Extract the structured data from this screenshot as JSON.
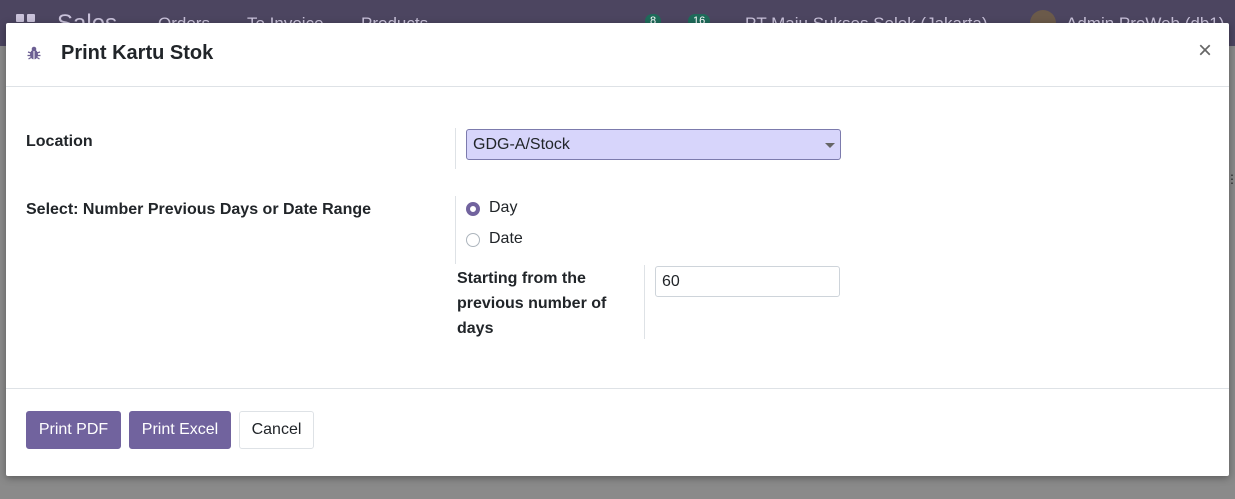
{
  "background": {
    "app_name": "Sales",
    "menu": [
      "Orders",
      "To Invoice",
      "Products"
    ],
    "messages_count": "8",
    "activities_count": "16",
    "company": "PT Maju Sukses Solok (Jakarta)",
    "user": "Admin ProWeb (db1)"
  },
  "dialog": {
    "title": "Print Kartu Stok",
    "title_icon": "bug-icon",
    "close_label": "×",
    "location_label": "Location",
    "location_value": "GDG-A/Stock",
    "period_label": "Select: Number Previous Days or Date Range",
    "period_options": [
      {
        "label": "Day",
        "checked": true
      },
      {
        "label": "Date",
        "checked": false
      }
    ],
    "days_label": "Starting from the previous number of days",
    "days_value": "60",
    "buttons": {
      "print_pdf": "Print PDF",
      "print_excel": "Print Excel",
      "cancel": "Cancel"
    }
  },
  "colors": {
    "primary": "#71639e",
    "select_bg": "#d7d5fb",
    "navbar": "#4c4560"
  }
}
